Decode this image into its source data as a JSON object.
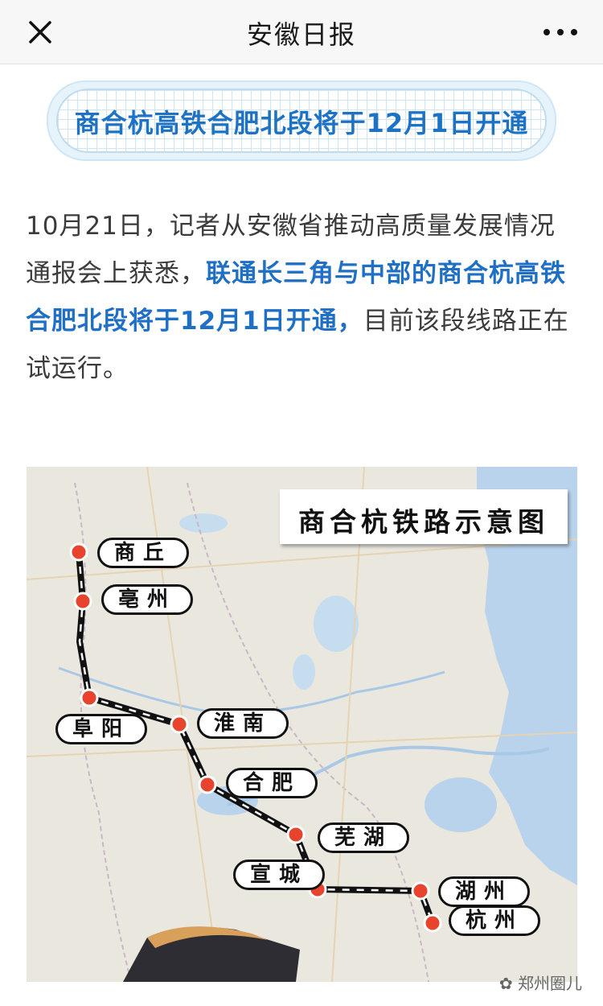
{
  "navbar": {
    "title": "安徽日报",
    "close_icon": "close-icon",
    "more_icon": "more-dots-icon"
  },
  "banner": {
    "text": "商合杭高铁合肥北段将于12月1日开通"
  },
  "article": {
    "part1": "10月21日，记者从安徽省推动高质量发展情况通报会上获悉，",
    "highlight": "联通长三角与中部的商合杭高铁合肥北段将于12月1日开通，",
    "part2": "目前该段线路正在试运行。"
  },
  "map": {
    "title": "商合杭铁路示意图",
    "cities": [
      "商丘",
      "亳州",
      "阜阳",
      "淮南",
      "合肥",
      "芜湖",
      "宣城",
      "湖州",
      "杭州"
    ],
    "colors": {
      "route": "#111111",
      "station": "#e8432d",
      "water": "#b9d3ec",
      "land": "#eae7df"
    }
  },
  "watermark": "郑州圈儿"
}
